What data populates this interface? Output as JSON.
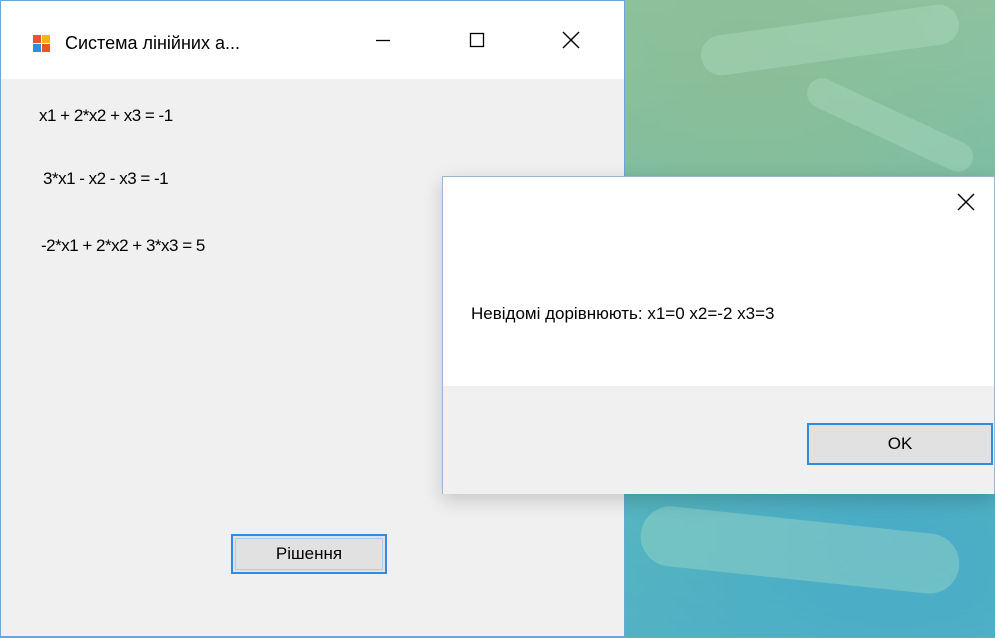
{
  "main_window": {
    "title": "Система лінійних а...",
    "equations": [
      "x1 + 2*x2 + x3 = -1",
      "3*x1 - x2 - x3 = -1",
      "-2*x1 + 2*x2 + 3*x3 = 5"
    ],
    "solve_button": "Рішення"
  },
  "message_box": {
    "text": "Невідомі дорівнюють: x1=0 x2=-2 x3=3",
    "ok_button": "OK"
  },
  "icons": [
    "app-icon",
    "minimize-icon",
    "maximize-icon",
    "close-icon"
  ],
  "colors": {
    "accent": "#2f8ce0",
    "window_bg": "#f0f0f0",
    "button_bg": "#e1e1e1"
  }
}
